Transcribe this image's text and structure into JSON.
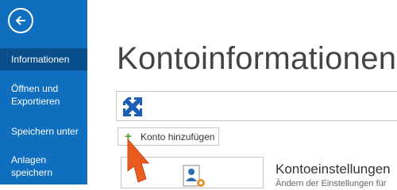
{
  "sidebar": {
    "items": [
      {
        "label": "Informationen",
        "active": true
      },
      {
        "label": "Öffnen und Exportieren"
      },
      {
        "label": "Speichern unter"
      },
      {
        "label": "Anlagen speichern"
      }
    ],
    "background_color": "#106ebe",
    "active_color": "#0a4f8c",
    "back_icon": "back-arrow-icon"
  },
  "main": {
    "title": "Kontoinformationen",
    "account_icon": "exchange-icon",
    "add_account_label": "Konto hinzufügen",
    "settings": {
      "title": "Kontoeinstellungen",
      "description": "Ändern der Einstellungen für"
    }
  }
}
